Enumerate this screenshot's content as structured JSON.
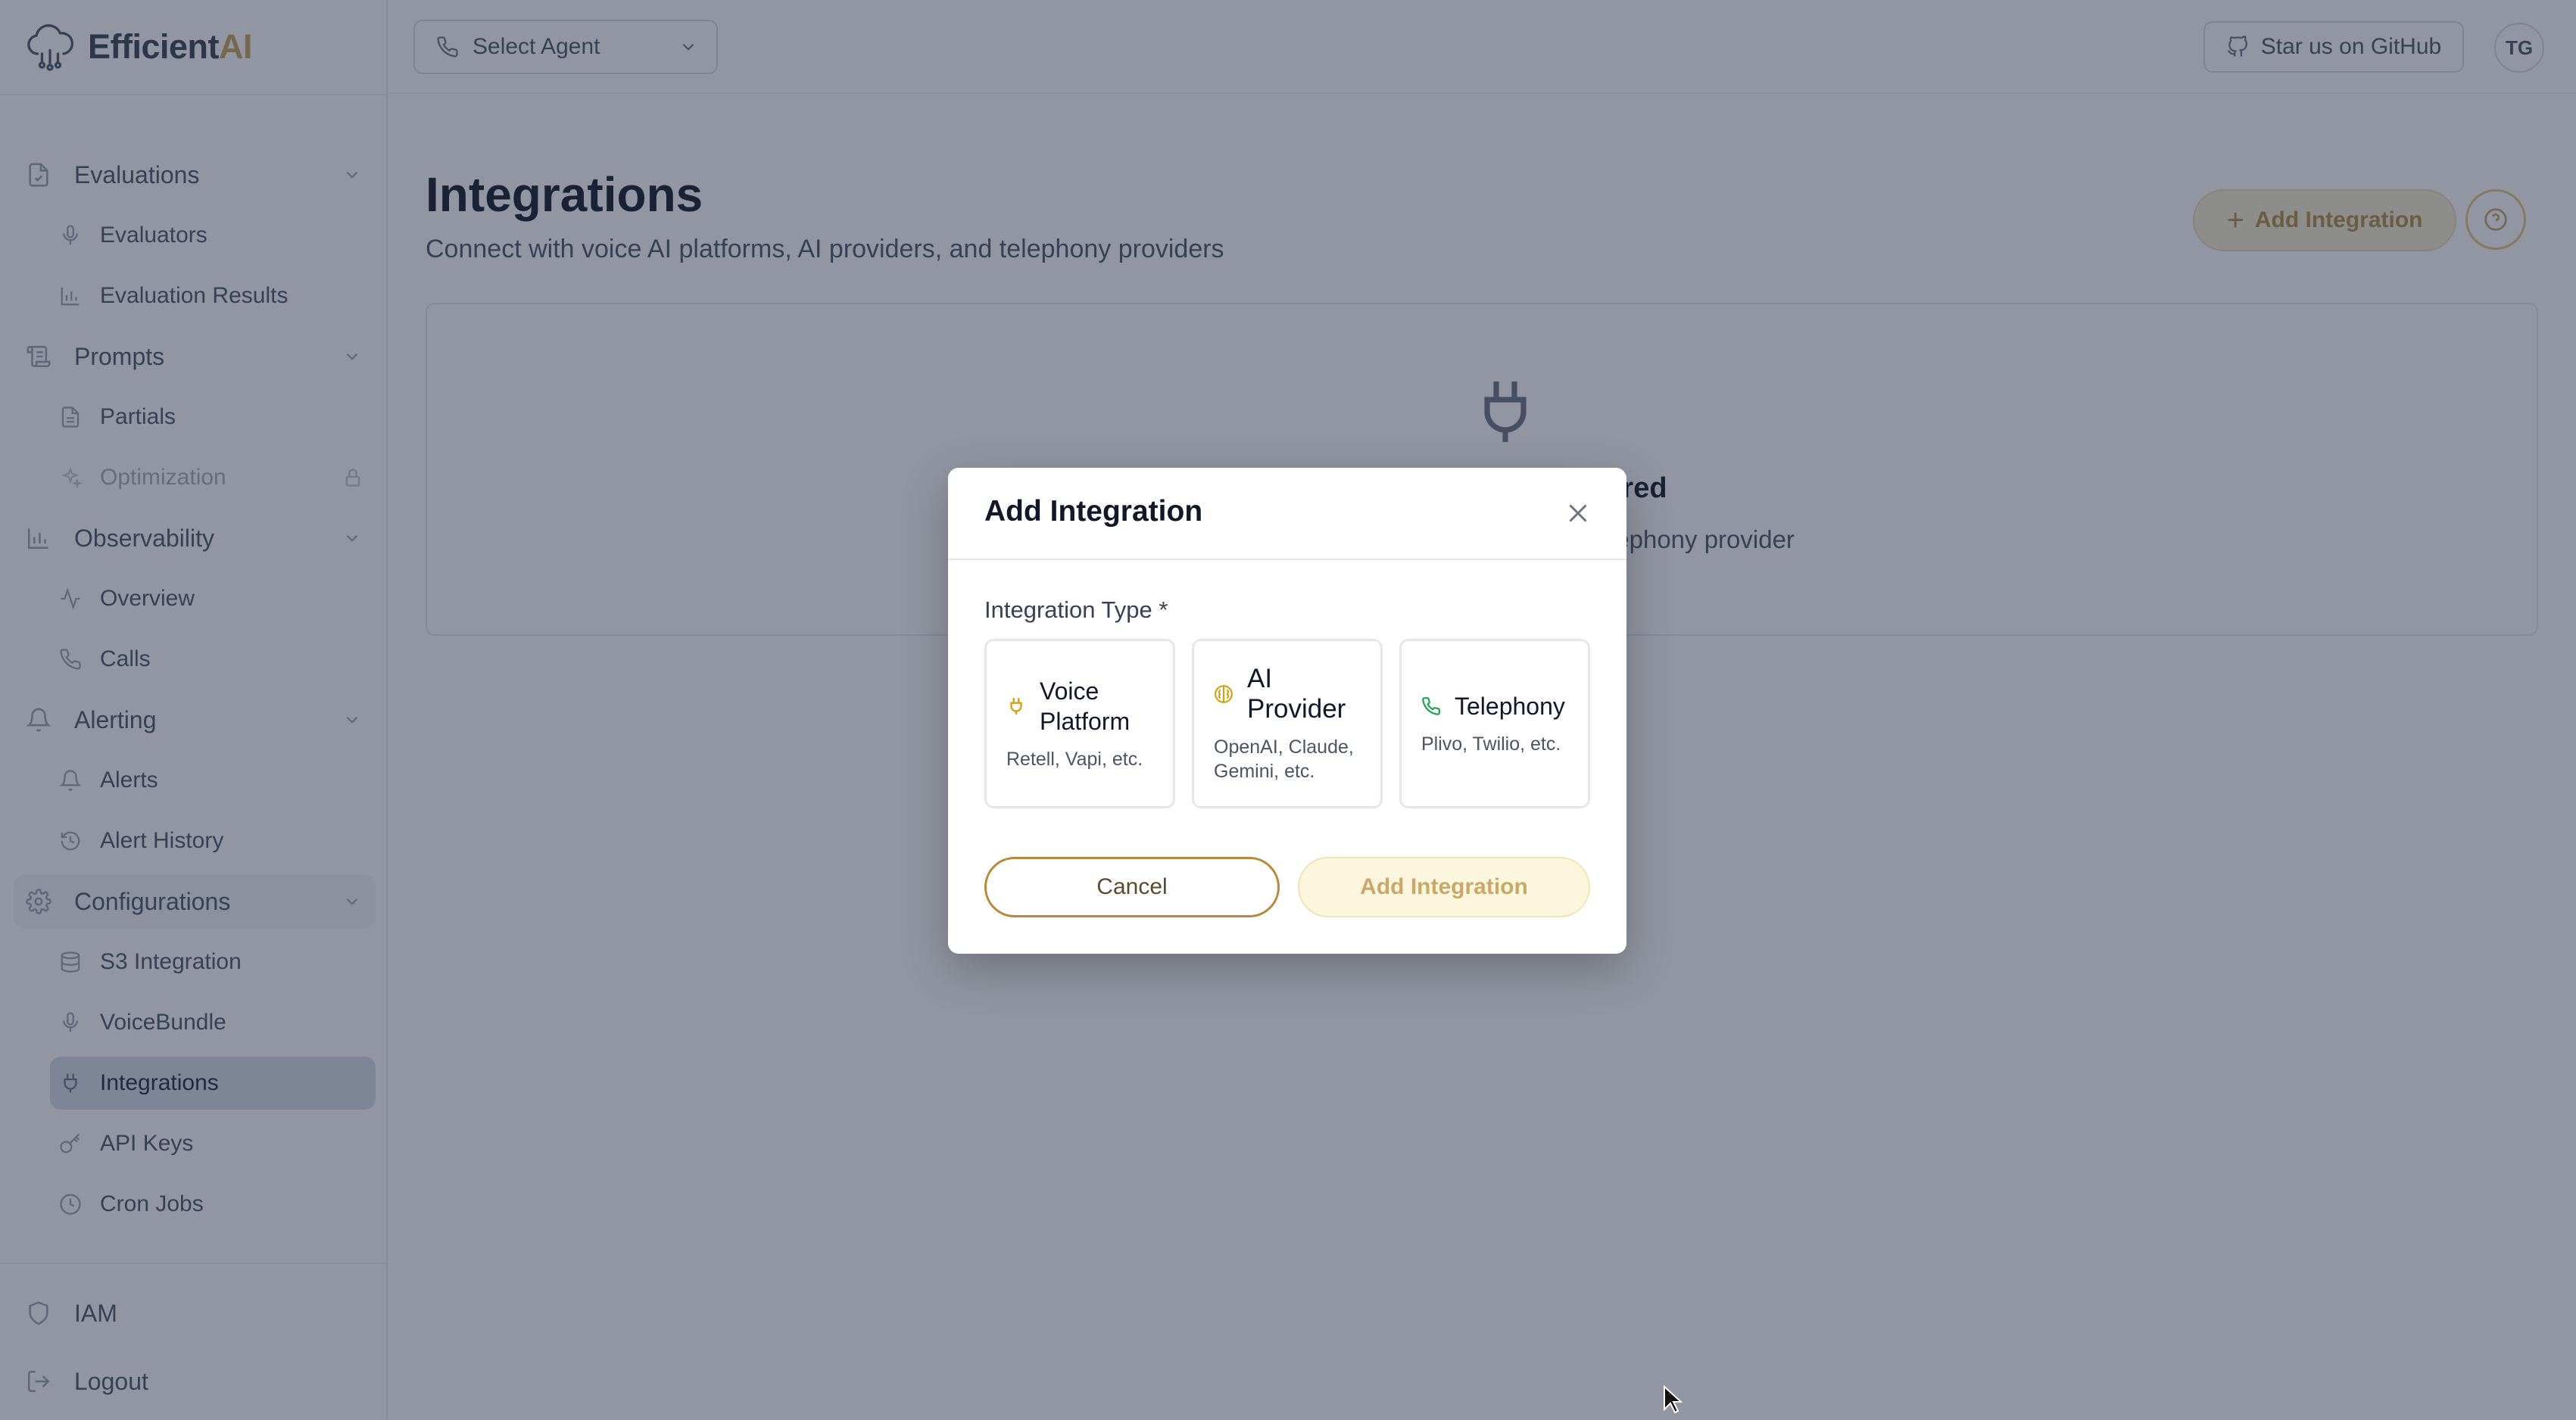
{
  "app": {
    "logo_main": "Efficient",
    "logo_accent": "AI"
  },
  "sidebar": {
    "items": [
      {
        "label": "Evaluations",
        "icon": "file-check-icon",
        "type": "group"
      },
      {
        "label": "Evaluators",
        "icon": "mic-icon",
        "type": "sub"
      },
      {
        "label": "Evaluation Results",
        "icon": "bar-chart-icon",
        "type": "sub"
      },
      {
        "label": "Prompts",
        "icon": "scroll-icon",
        "type": "group"
      },
      {
        "label": "Partials",
        "icon": "file-text-icon",
        "type": "sub"
      },
      {
        "label": "Optimization",
        "icon": "sparkles-icon",
        "type": "sub",
        "disabled": true
      },
      {
        "label": "Observability",
        "icon": "bar-chart-icon",
        "type": "group"
      },
      {
        "label": "Overview",
        "icon": "activity-icon",
        "type": "sub"
      },
      {
        "label": "Calls",
        "icon": "phone-icon",
        "type": "sub"
      },
      {
        "label": "Alerting",
        "icon": "bell-icon",
        "type": "group"
      },
      {
        "label": "Alerts",
        "icon": "bell-icon",
        "type": "sub"
      },
      {
        "label": "Alert History",
        "icon": "history-icon",
        "type": "sub"
      },
      {
        "label": "Configurations",
        "icon": "gear-icon",
        "type": "group",
        "highlight": true
      },
      {
        "label": "S3 Integration",
        "icon": "database-icon",
        "type": "sub"
      },
      {
        "label": "VoiceBundle",
        "icon": "mic-icon",
        "type": "sub"
      },
      {
        "label": "Integrations",
        "icon": "plug-icon",
        "type": "sub",
        "active": true
      },
      {
        "label": "API Keys",
        "icon": "key-icon",
        "type": "sub"
      },
      {
        "label": "Cron Jobs",
        "icon": "clock-icon",
        "type": "sub"
      }
    ],
    "bottom": [
      {
        "label": "IAM",
        "icon": "shield-icon"
      },
      {
        "label": "Logout",
        "icon": "logout-icon"
      }
    ]
  },
  "header": {
    "agent_select_label": "Select Agent",
    "github_label": "Star us on GitHub",
    "avatar_initials": "TG"
  },
  "main": {
    "title": "Integrations",
    "subtitle": "Connect with voice AI platforms, AI providers, and telephony providers",
    "add_button_label": "Add Integration",
    "empty_title_visible": "red",
    "empty_text_visible": "er, or telephony provider"
  },
  "modal": {
    "title": "Add Integration",
    "field_label": "Integration Type *",
    "types": [
      {
        "name": "Voice Platform",
        "desc": "Retell, Vapi, etc.",
        "icon": "plug-icon",
        "color": "#d4a017"
      },
      {
        "name": "AI Provider",
        "desc": "OpenAI, Claude, Gemini, etc.",
        "icon": "brain-icon",
        "color": "#d4a017"
      },
      {
        "name": "Telephony",
        "desc": "Plivo, Twilio, etc.",
        "icon": "phone-icon",
        "color": "#16a34a"
      }
    ],
    "cancel_label": "Cancel",
    "submit_label": "Add Integration"
  },
  "colors": {
    "accent": "#c9a15a",
    "overlay": "#232e46",
    "active_nav": "#d8dde6"
  }
}
